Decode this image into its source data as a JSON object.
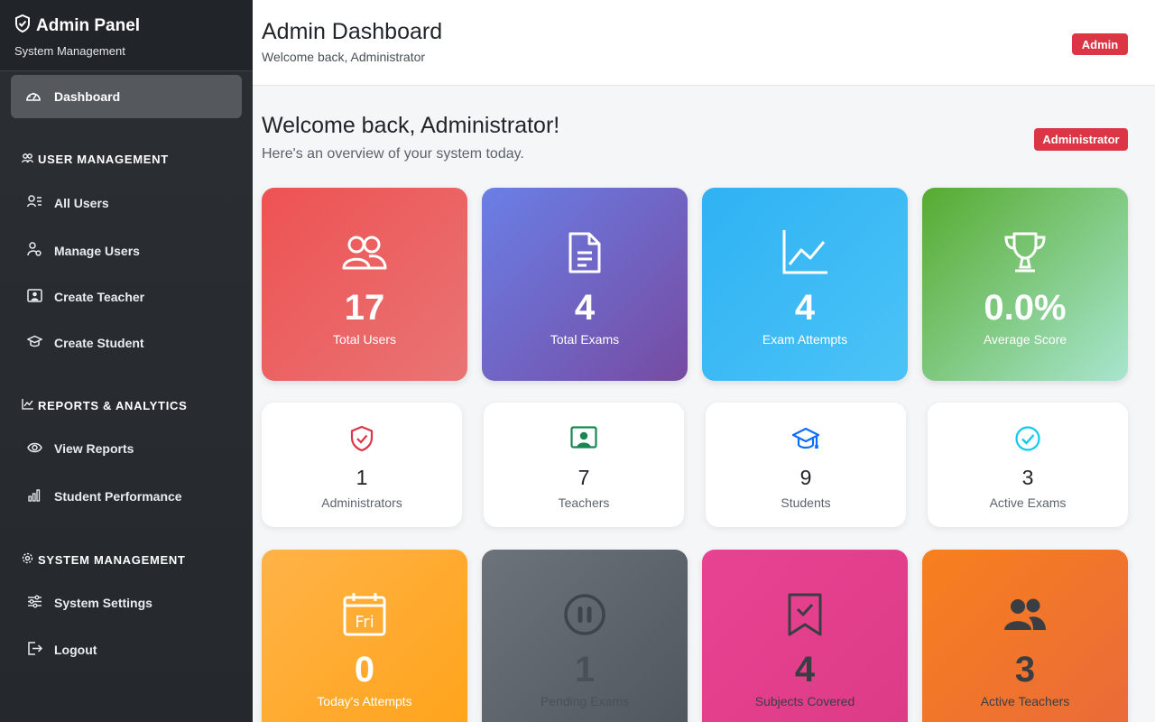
{
  "sidebar": {
    "brand_title": "Admin Panel",
    "brand_subtitle": "System Management",
    "active_item": "Dashboard",
    "sections": [
      {
        "title": "USER MANAGEMENT",
        "items": [
          "All Users",
          "Manage Users",
          "Create Teacher",
          "Create Student"
        ]
      },
      {
        "title": "REPORTS & ANALYTICS",
        "items": [
          "View Reports",
          "Student Performance"
        ]
      },
      {
        "title": "SYSTEM MANAGEMENT",
        "items": [
          "System Settings",
          "Logout"
        ]
      }
    ]
  },
  "header": {
    "title": "Admin Dashboard",
    "subtitle": "Welcome back, Administrator",
    "role_badge": "Admin"
  },
  "welcome": {
    "title": "Welcome back, Administrator!",
    "subtitle": "Here's an overview of your system today.",
    "badge": "Administrator"
  },
  "stats_primary": [
    {
      "value": "17",
      "label": "Total Users",
      "icon": "users-icon"
    },
    {
      "value": "4",
      "label": "Total Exams",
      "icon": "document-icon"
    },
    {
      "value": "4",
      "label": "Exam Attempts",
      "icon": "line-chart-icon"
    },
    {
      "value": "0.0%",
      "label": "Average Score",
      "icon": "trophy-icon"
    }
  ],
  "stats_secondary": [
    {
      "value": "1",
      "label": "Administrators",
      "icon": "shield-check-icon",
      "color": "#dc3545"
    },
    {
      "value": "7",
      "label": "Teachers",
      "icon": "teacher-icon",
      "color": "#198754"
    },
    {
      "value": "9",
      "label": "Students",
      "icon": "graduation-cap-icon",
      "color": "#0d6efd"
    },
    {
      "value": "3",
      "label": "Active Exams",
      "icon": "check-circle-icon",
      "color": "#0dcaf0"
    }
  ],
  "stats_tertiary": [
    {
      "value": "0",
      "label": "Today's Attempts",
      "icon": "calendar-icon",
      "icon_text": "Fri"
    },
    {
      "value": "1",
      "label": "Pending Exams",
      "icon": "pause-circle-icon"
    },
    {
      "value": "4",
      "label": "Subjects Covered",
      "icon": "bookmark-check-icon"
    },
    {
      "value": "3",
      "label": "Active Teachers",
      "icon": "people-fill-icon"
    }
  ]
}
